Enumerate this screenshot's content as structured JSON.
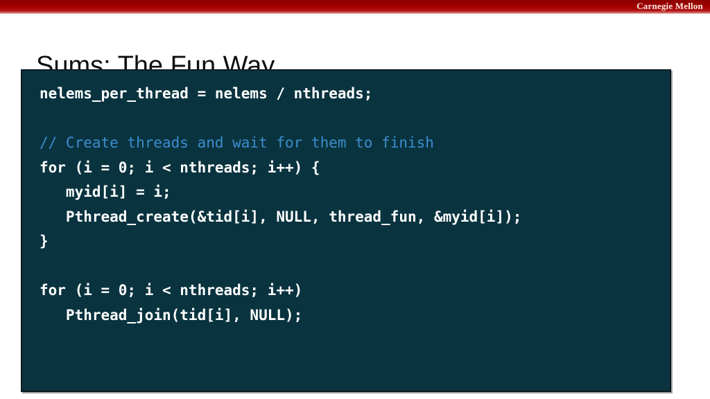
{
  "brand": {
    "name": "Carnegie Mellon",
    "bar_color": "#a00000",
    "text_color": "#f7ece2"
  },
  "slide": {
    "title": "Sums: The Fun Way",
    "title_color": "#101010"
  },
  "code_panel": {
    "background_color": "#09333F",
    "border_color": "#0c1b22",
    "default_text_color": "#ffffff",
    "comment_color": "#3d8ece",
    "lines": [
      {
        "text": "nelems_per_thread = nelems / nthreads;",
        "kind": "code"
      },
      {
        "text": " ",
        "kind": "blank"
      },
      {
        "text": "// Create threads and wait for them to finish",
        "kind": "comment"
      },
      {
        "text": "for (i = 0; i < nthreads; i++) {",
        "kind": "code"
      },
      {
        "text": "   myid[i] = i;",
        "kind": "code"
      },
      {
        "text": "   Pthread_create(&tid[i], NULL, thread_fun, &myid[i]);",
        "kind": "code"
      },
      {
        "text": "}",
        "kind": "code"
      },
      {
        "text": " ",
        "kind": "blank"
      },
      {
        "text": "for (i = 0; i < nthreads; i++)",
        "kind": "code"
      },
      {
        "text": "   Pthread_join(tid[i], NULL);",
        "kind": "code"
      },
      {
        "text": " ",
        "kind": "blank"
      },
      {
        "text": " ",
        "kind": "blank"
      }
    ]
  }
}
